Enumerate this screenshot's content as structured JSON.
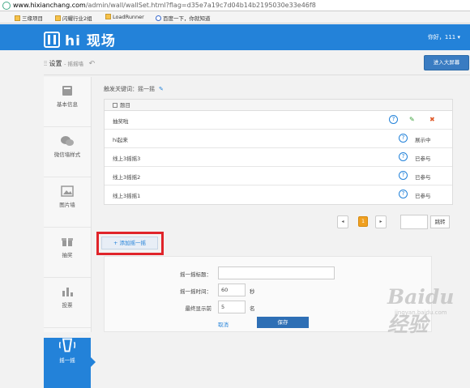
{
  "browser": {
    "url_host": "www.hixianchang.com",
    "url_path": "/admin/wall/wallSet.html?flag=d35e7a19c7d04b14b2195030e33e46f8",
    "bookmarks": [
      "三缘项目",
      "闪耀行业2组",
      "LoadRunner",
      "百度一下，你就知道"
    ]
  },
  "header": {
    "logo_text": "hi 现场",
    "user": "你好，111 ▾"
  },
  "subheader": {
    "title": "设置",
    "subtitle": "- 摇摇墙",
    "big_screen_label": "进入大屏幕"
  },
  "sidebar": {
    "items": [
      {
        "label": "基本信息",
        "icon": "book-icon"
      },
      {
        "label": "微信墙样式",
        "icon": "wechat-icon"
      },
      {
        "label": "图片墙",
        "icon": "image-icon"
      },
      {
        "label": "抽奖",
        "icon": "gift-icon"
      },
      {
        "label": "投票",
        "icon": "chart-icon"
      },
      {
        "label": "摇一摇",
        "icon": "phone-shake-icon"
      }
    ]
  },
  "main": {
    "trigger_keyword": "触发关键词：摇一摇",
    "table": {
      "header": "题目",
      "rows": [
        {
          "name": "抽奖啦",
          "status": ""
        },
        {
          "name": "hi起来",
          "status": "展示中"
        },
        {
          "name": "线上3摇摇3",
          "status": "已参与"
        },
        {
          "name": "线上3摇摇2",
          "status": "已参与"
        },
        {
          "name": "线上3摇摇1",
          "status": "已参与"
        }
      ]
    },
    "pager": {
      "prev": "◂",
      "current": "1",
      "next": "▸",
      "go": "跳转"
    },
    "add_button": "+ 添加摇一摇",
    "form": {
      "title_label": "摇一摇标题：",
      "title_value": "",
      "time_label": "摇一摇时间：",
      "time_value": "60",
      "time_unit": "秒",
      "top_label": "最终显示前",
      "top_value": "5",
      "top_unit": "名",
      "cancel": "取消",
      "save": "保存"
    }
  },
  "watermark": {
    "text": "Baidu经验",
    "sub": "jingyan.baidu.com"
  }
}
